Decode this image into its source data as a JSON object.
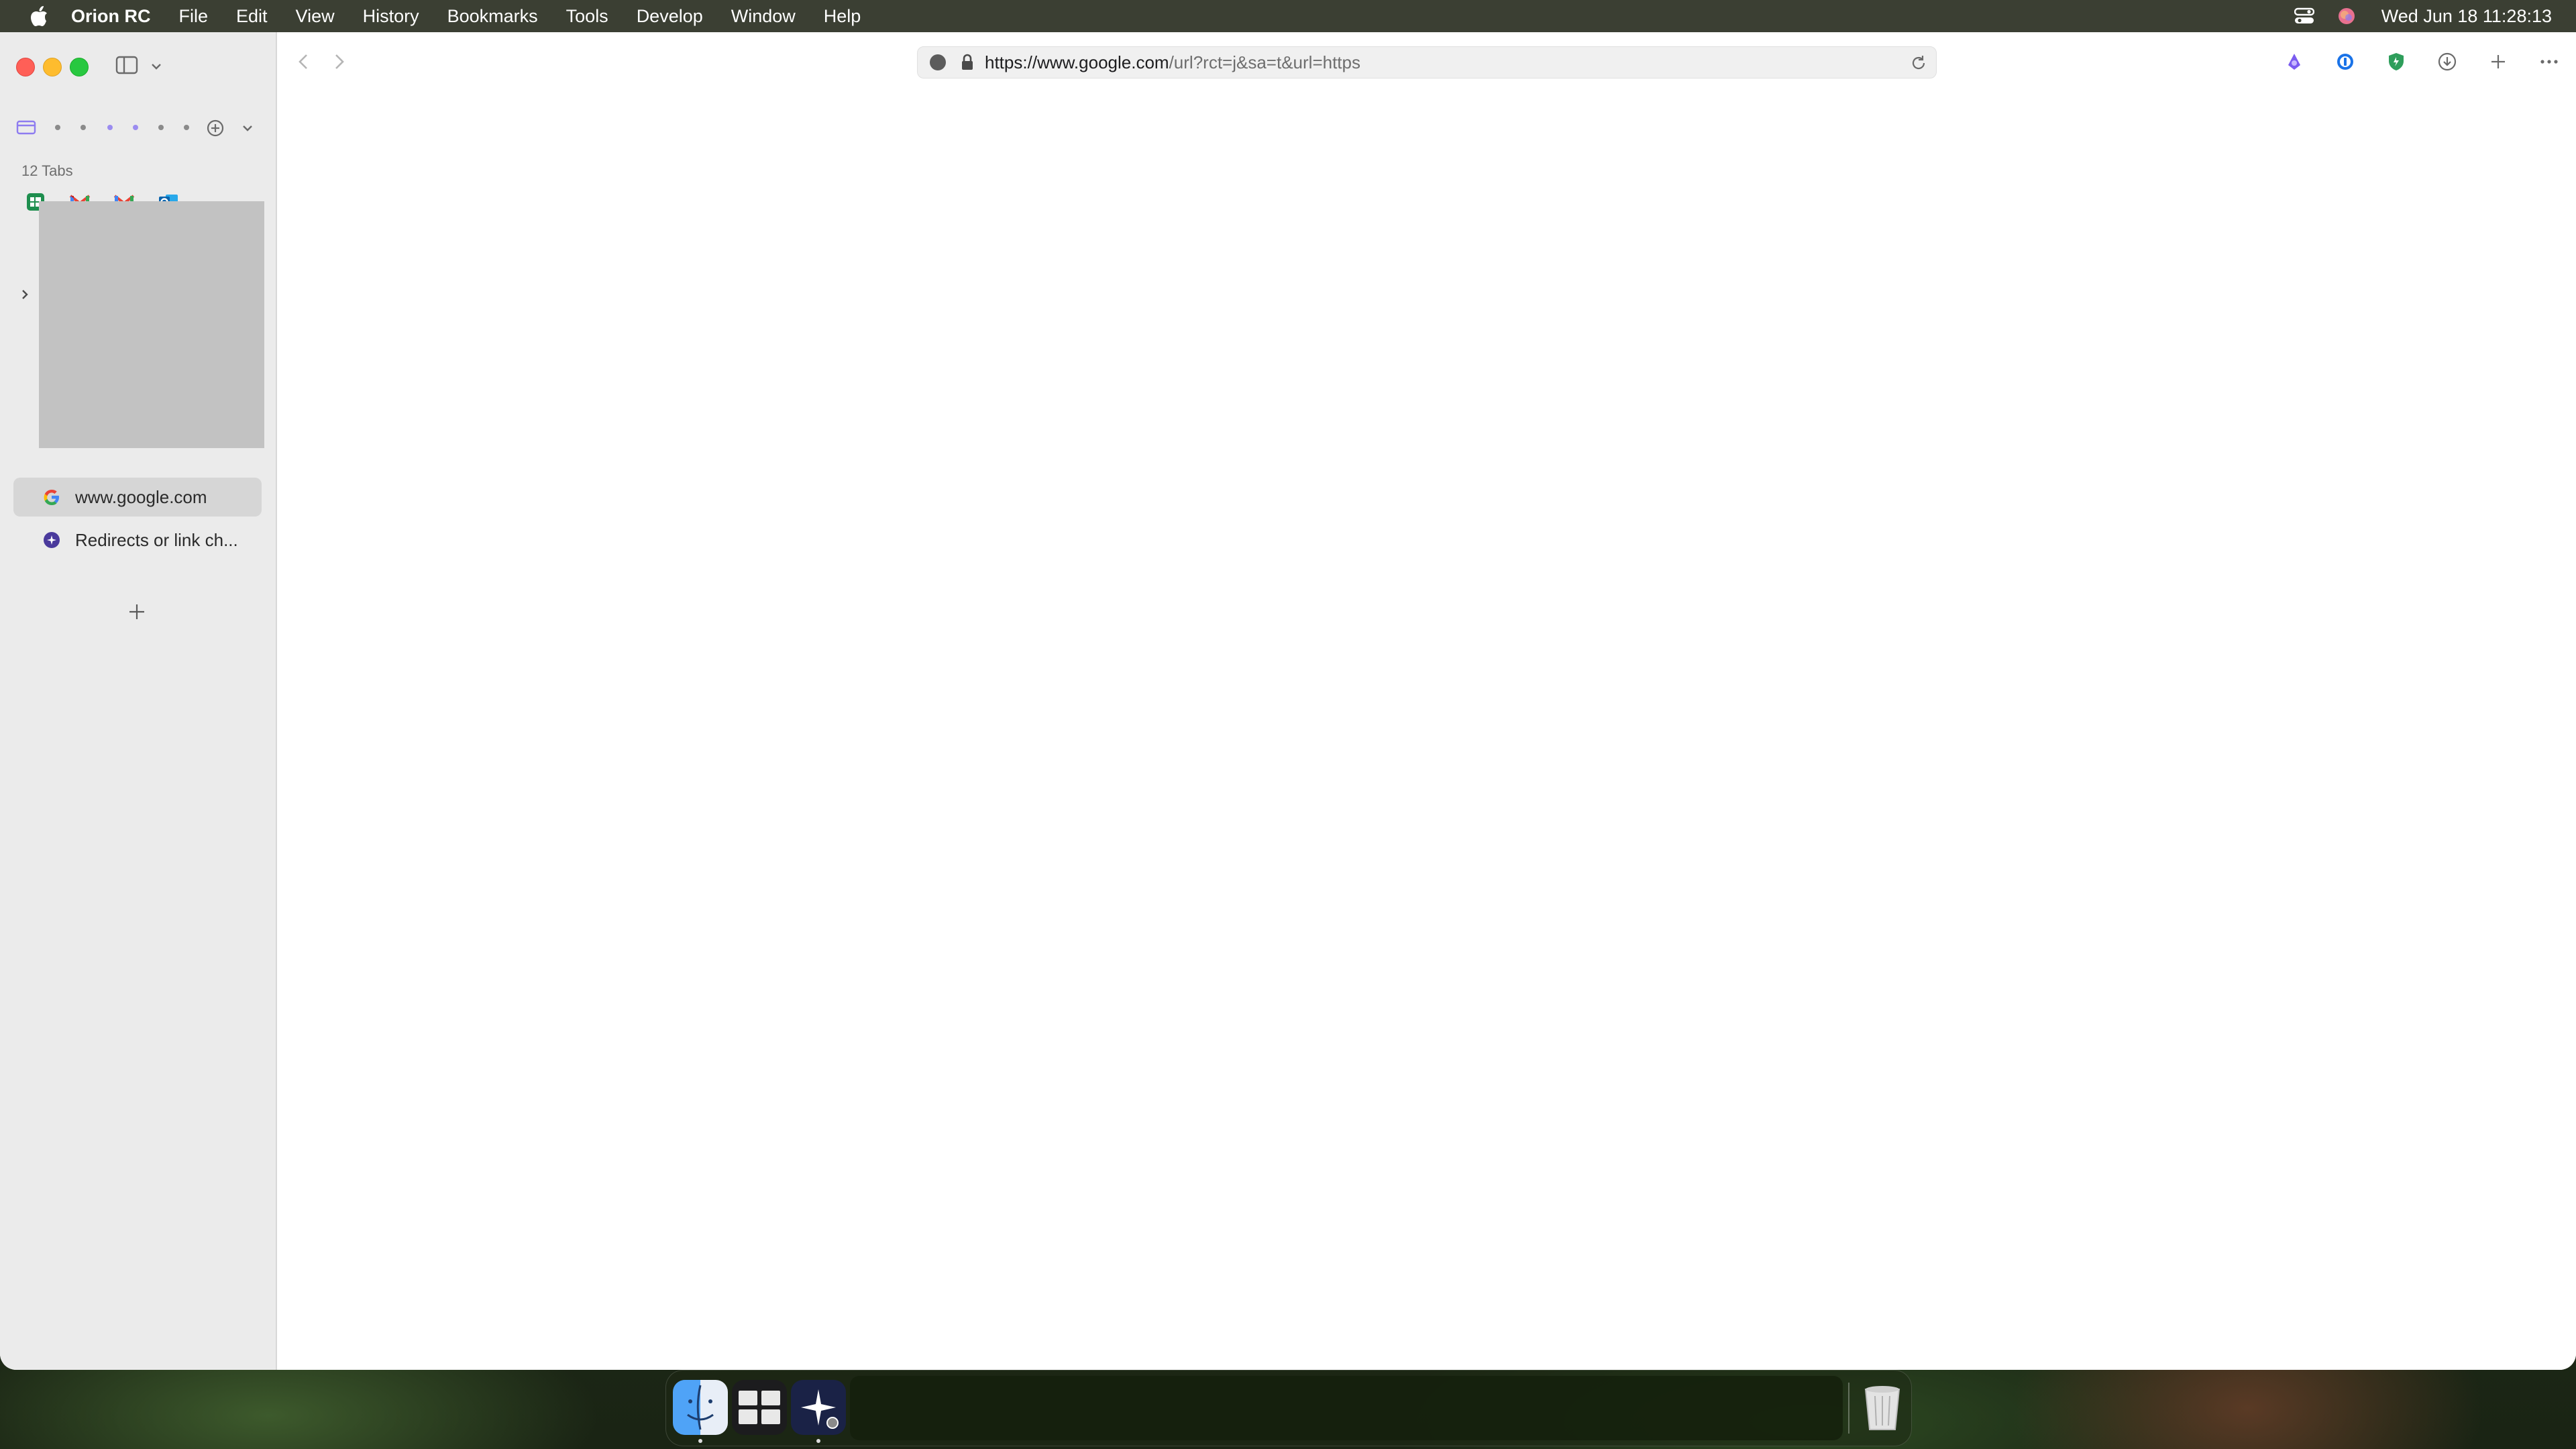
{
  "menubar": {
    "app_name": "Orion RC",
    "items": [
      "File",
      "Edit",
      "View",
      "History",
      "Bookmarks",
      "Tools",
      "Develop",
      "Window",
      "Help"
    ],
    "clock": "Wed Jun 18  11:28:13"
  },
  "sidebar": {
    "tabs_count": "12 Tabs",
    "pinned": [
      "sheets-icon",
      "gmail-icon",
      "gmail-icon",
      "outlook-icon"
    ],
    "tabs": [
      {
        "title": "www.google.com",
        "icon": "google-g-icon",
        "active": true
      },
      {
        "title": "Redirects or link ch...",
        "icon": "orion-icon",
        "active": false
      }
    ]
  },
  "addressbar": {
    "url_host": "https://www.google.com",
    "url_path": "/url?rct=j&sa=t&url=https"
  },
  "colors": {
    "accent": "#9b8cf0",
    "close": "#ff5f57",
    "minimize": "#febc2e",
    "maximize": "#28c840"
  }
}
